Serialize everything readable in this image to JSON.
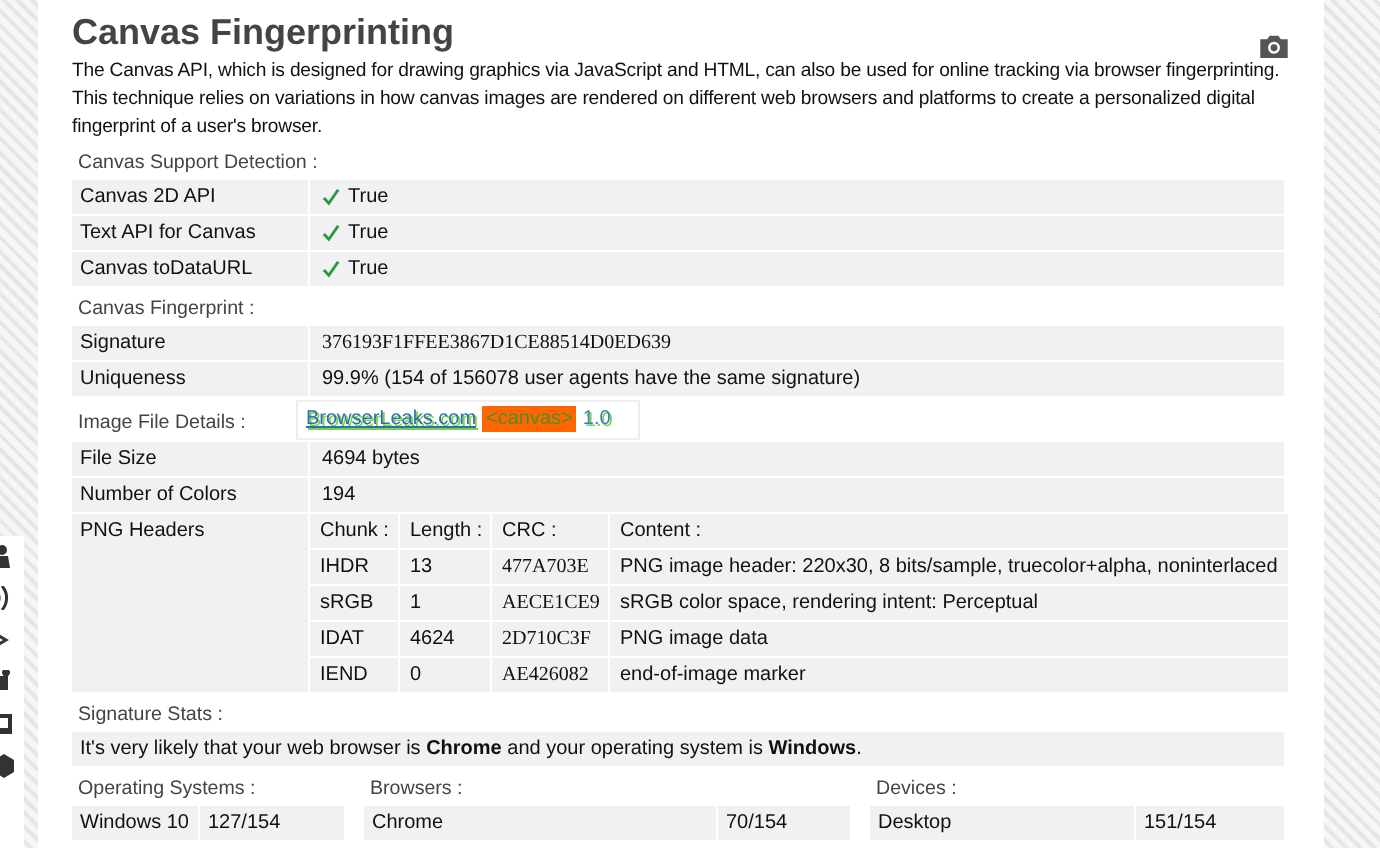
{
  "title": "Canvas Fingerprinting",
  "description": "The Canvas API, which is designed for drawing graphics via JavaScript and HTML, can also be used for online tracking via browser fingerprinting. This technique relies on variations in how canvas images are rendered on different web browsers and platforms to create a personalized digital fingerprint of a user's browser.",
  "support_detection": {
    "label": "Canvas Support Detection :",
    "rows": [
      {
        "name": "Canvas 2D API",
        "value": "True",
        "supported": true
      },
      {
        "name": "Text API for Canvas",
        "value": "True",
        "supported": true
      },
      {
        "name": "Canvas toDataURL",
        "value": "True",
        "supported": true
      }
    ]
  },
  "fingerprint": {
    "label": "Canvas Fingerprint :",
    "rows": [
      {
        "name": "Signature",
        "value": "376193F1FFEE3867D1CE88514D0ED639",
        "kind": "mono"
      },
      {
        "name": "Uniqueness",
        "value": "99.9% (154 of 156078 user agents have the same signature)",
        "kind": "text"
      }
    ]
  },
  "image_file": {
    "label": "Image File Details :",
    "canvas_render": [
      "BrowserLeaks.com",
      "<canvas>",
      "1.0"
    ],
    "rows": [
      {
        "name": "File Size",
        "value": "4694 bytes"
      },
      {
        "name": "Number of Colors",
        "value": "194"
      }
    ],
    "png_headers": {
      "name": "PNG Headers",
      "columns": [
        "Chunk :",
        "Length :",
        "CRC :",
        "Content :"
      ],
      "rows": [
        [
          "IHDR",
          "13",
          "477A703E",
          "PNG image header: 220x30, 8 bits/sample, truecolor+alpha, noninterlaced"
        ],
        [
          "sRGB",
          "1",
          "AECE1CE9",
          "sRGB color space, rendering intent: Perceptual"
        ],
        [
          "IDAT",
          "4624",
          "2D710C3F",
          "PNG image data"
        ],
        [
          "IEND",
          "0",
          "AE426082",
          "end-of-image marker"
        ]
      ]
    }
  },
  "signature_stats": {
    "label": "Signature Stats :",
    "summary": "It's very likely that your web browser is **Chrome** and your operating system is **Windows**.",
    "groups": [
      {
        "label": "Operating Systems :",
        "rows": [
          [
            "Windows 10",
            "127/154"
          ]
        ]
      },
      {
        "label": "Browsers :",
        "rows": [
          [
            "Chrome",
            "70/154"
          ]
        ]
      },
      {
        "label": "Devices :",
        "rows": [
          [
            "Desktop",
            "151/154"
          ]
        ]
      }
    ]
  }
}
